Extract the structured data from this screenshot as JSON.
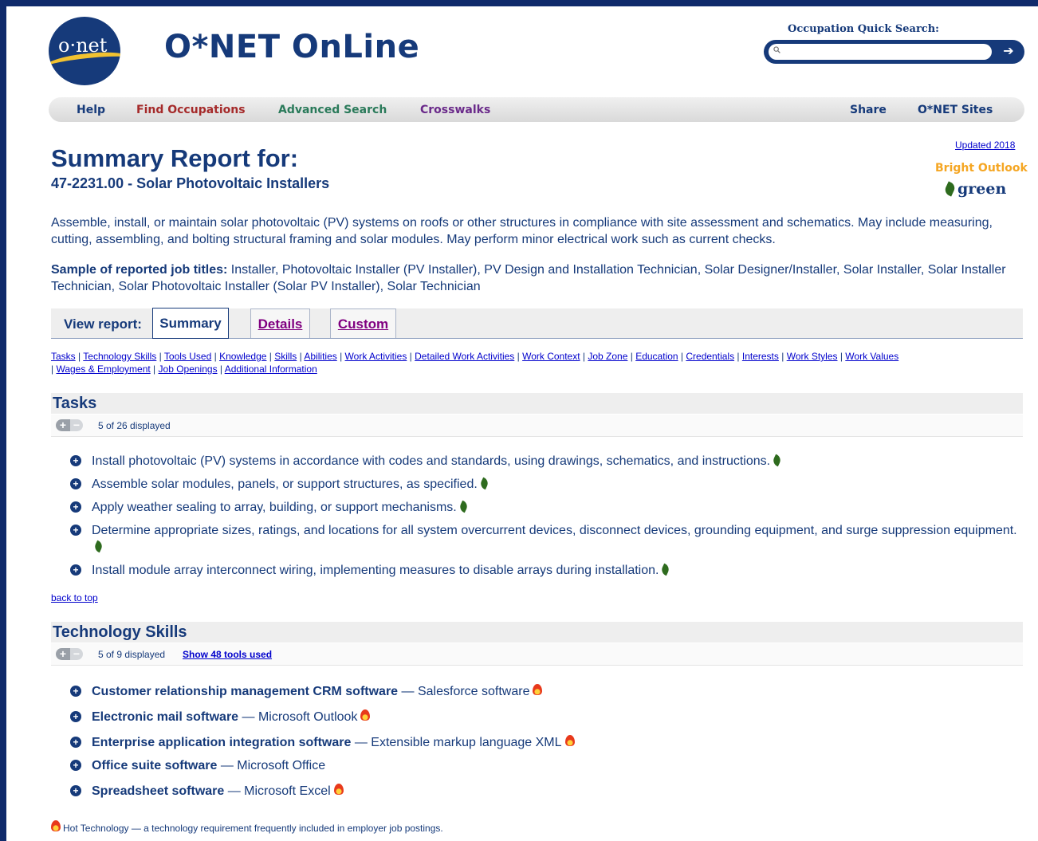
{
  "header": {
    "logo_text": "o·net",
    "site_title": "O*NET OnLine",
    "quick_search_label": "Occupation Quick Search:",
    "quick_search_value": "",
    "quick_search_placeholder": ""
  },
  "nav": {
    "help": "Help",
    "find": "Find Occupations",
    "advanced": "Advanced Search",
    "crosswalks": "Crosswalks",
    "share": "Share",
    "sites": "O*NET Sites"
  },
  "summary": {
    "heading": "Summary Report for:",
    "code_title": "47-2231.00 - Solar Photovoltaic Installers",
    "updated": "Updated 2018",
    "bright_outlook": "Bright Outlook",
    "green": "green",
    "description": "Assemble, install, or maintain solar photovoltaic (PV) systems on roofs or other structures in compliance with site assessment and schematics. May include measuring, cutting, assembling, and bolting structural framing and solar modules. May perform minor electrical work such as current checks.",
    "sample_label": "Sample of reported job titles:",
    "sample_titles": " Installer, Photovoltaic Installer (PV Installer), PV Design and Installation Technician, Solar Designer/Installer, Solar Installer, Solar Installer Technician, Solar Photovoltaic Installer (Solar PV Installer), Solar Technician"
  },
  "report": {
    "label": "View report:",
    "tabs": [
      "Summary",
      "Details",
      "Custom"
    ]
  },
  "section_links": [
    "Tasks",
    "Technology Skills",
    "Tools Used",
    "Knowledge",
    "Skills",
    "Abilities",
    "Work Activities",
    "Detailed Work Activities",
    "Work Context",
    "Job Zone",
    "Education",
    "Credentials",
    "Interests",
    "Work Styles",
    "Work Values",
    "Wages & Employment",
    "Job Openings",
    "Additional Information"
  ],
  "tasks": {
    "heading": "Tasks",
    "displayed": "5 of 26 displayed",
    "items": [
      "Install photovoltaic (PV) systems in accordance with codes and standards, using drawings, schematics, and instructions.",
      "Assemble solar modules, panels, or support structures, as specified.",
      "Apply weather sealing to array, building, or support mechanisms.",
      "Determine appropriate sizes, ratings, and locations for all system overcurrent devices, disconnect devices, grounding equipment, and surge suppression equipment.",
      "Install module array interconnect wiring, implementing measures to disable arrays during installation."
    ]
  },
  "back_to_top": "back to top",
  "tech": {
    "heading": "Technology Skills",
    "displayed": "5 of 9 displayed",
    "show_tools": "Show 48 tools used",
    "items": [
      {
        "category": "Customer relationship management CRM software",
        "example": " — Salesforce software"
      },
      {
        "category": "Electronic mail software",
        "example": " — Microsoft Outlook"
      },
      {
        "category": "Enterprise application integration software",
        "example": " — Extensible markup language XML"
      },
      {
        "category": "Office suite software",
        "example": " — Microsoft Office"
      },
      {
        "category": "Spreadsheet software",
        "example": " — Microsoft Excel"
      }
    ]
  },
  "hot_note": "Hot Technology — a technology requirement frequently included in employer job postings.",
  "colors": {
    "frame": "#102a6b",
    "navy": "#163a7a",
    "find_occupations": "#a52a2a",
    "advanced_search": "#2a7a5a",
    "crosswalks": "#6a2a8a"
  }
}
